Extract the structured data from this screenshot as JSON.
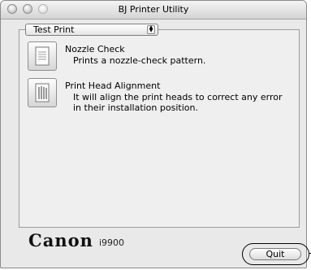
{
  "window": {
    "title": "BJ Printer Utility"
  },
  "popup": {
    "selected": "Test Print"
  },
  "items": [
    {
      "title": "Nozzle Check",
      "description": "Prints a nozzle-check pattern.",
      "icon": "nozzle-check-icon"
    },
    {
      "title": "Print Head Alignment",
      "description_line1": "It will align the print heads to correct any error",
      "description_line2": "in their installation position.",
      "icon": "print-head-alignment-icon"
    }
  ],
  "footer": {
    "brand": "Canon",
    "model": "i9900",
    "quit_label": "Quit"
  }
}
